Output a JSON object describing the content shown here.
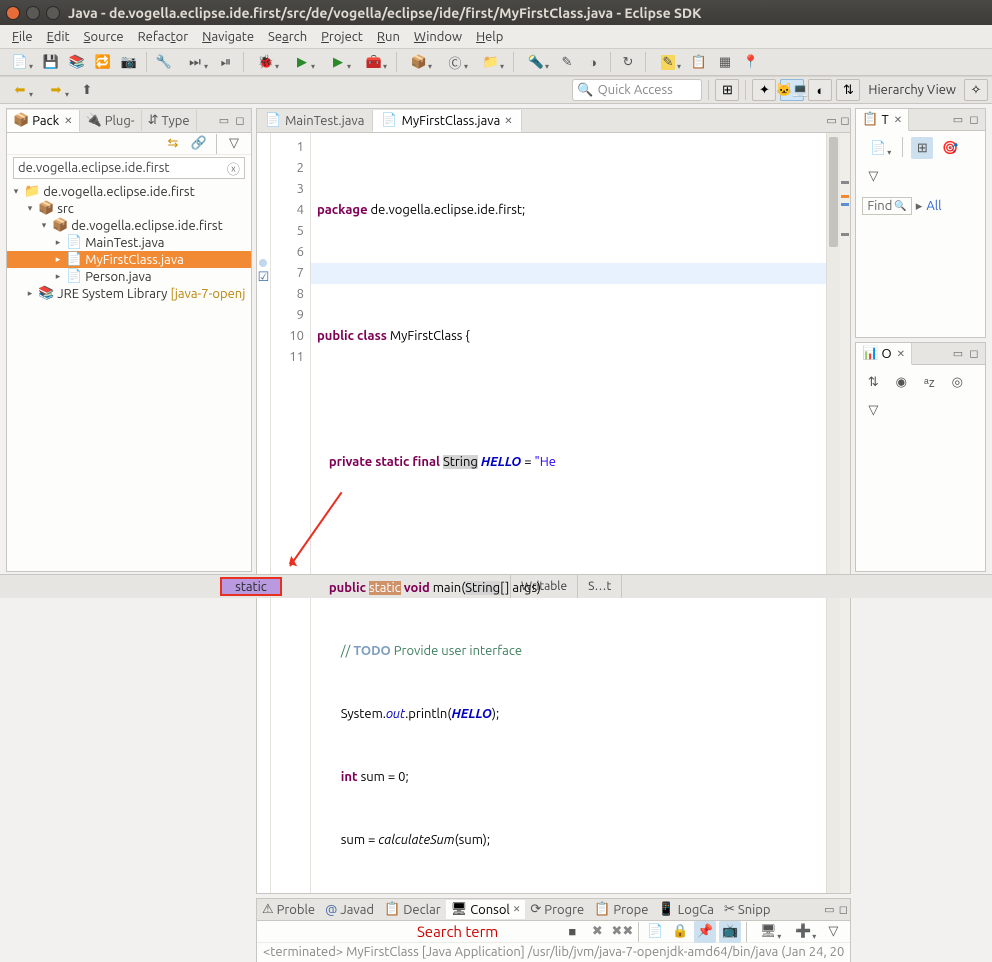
{
  "window": {
    "title": "Java - de.vogella.eclipse.ide.first/src/de/vogella/eclipse/ide/first/MyFirstClass.java - Eclipse SDK"
  },
  "menu": {
    "file": "File",
    "edit": "Edit",
    "source": "Source",
    "refactor": "Refactor",
    "navigate": "Navigate",
    "search": "Search",
    "project": "Project",
    "run": "Run",
    "window": "Window",
    "help": "Help"
  },
  "quick_access": {
    "placeholder": "Quick Access"
  },
  "perspective": {
    "label": "Hierarchy View"
  },
  "left": {
    "tabs": {
      "pack": "Pack",
      "plug": "Plug-",
      "type": "Type"
    },
    "filter_value": "de.vogella.eclipse.ide.first",
    "tree": {
      "project": "de.vogella.eclipse.ide.first",
      "src": "src",
      "pkg": "de.vogella.eclipse.ide.first",
      "f1": "MainTest.java",
      "f2": "MyFirstClass.java",
      "f3": "Person.java",
      "jre": "JRE System Library",
      "jre_suffix": "[java-7-openj"
    }
  },
  "editor": {
    "tabs": {
      "t1": "MainTest.java",
      "t2": "MyFirstClass.java"
    },
    "lines": [
      "1",
      "2",
      "3",
      "4",
      "5",
      "6",
      "7",
      "8",
      "9",
      "10",
      "11"
    ]
  },
  "bottom": {
    "tabs": {
      "proble": "Proble",
      "javad": "Javad",
      "declar": "Declar",
      "consol": "Consol",
      "progre": "Progre",
      "prope": "Prope",
      "logca": "LogCa",
      "snipp": "Snipp"
    },
    "search_label": "Search term",
    "console_text": "<terminated> MyFirstClass [Java Application] /usr/lib/jvm/java-7-openjdk-amd64/bin/java (Jan 24, 20"
  },
  "right": {
    "task_tab": "T",
    "find": "Find",
    "all": "All"
  },
  "status": {
    "search": "static",
    "writable": "Writable",
    "smart": "S…t"
  }
}
